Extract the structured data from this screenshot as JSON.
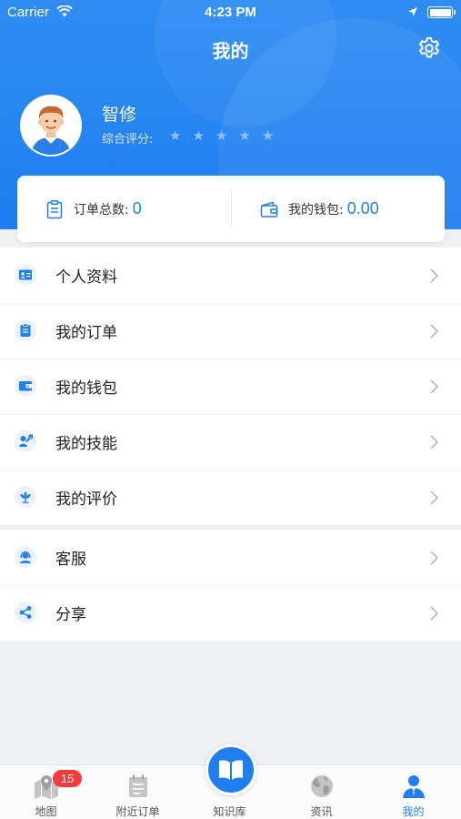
{
  "status_bar": {
    "carrier": "Carrier",
    "time": "4:23 PM"
  },
  "header": {
    "title": "我的"
  },
  "profile": {
    "name": "智修",
    "rating_label": "综合评分:",
    "rating_stars": 5,
    "rating_filled": 0
  },
  "stats": {
    "orders_label": "订单总数:",
    "orders_value": "0",
    "wallet_label": "我的钱包:",
    "wallet_value": "0.00"
  },
  "menu_group1": [
    {
      "label": "个人资料",
      "icon": "id-card-icon"
    },
    {
      "label": "我的订单",
      "icon": "clipboard-icon"
    },
    {
      "label": "我的钱包",
      "icon": "wallet-icon"
    },
    {
      "label": "我的技能",
      "icon": "wrench-icon"
    },
    {
      "label": "我的评价",
      "icon": "flower-icon"
    }
  ],
  "menu_group2": [
    {
      "label": "客服",
      "icon": "customer-service-icon"
    },
    {
      "label": "分享",
      "icon": "share-icon"
    }
  ],
  "tabbar": {
    "tabs": [
      {
        "label": "地图",
        "icon": "map-pin-icon",
        "badge": "15"
      },
      {
        "label": "附近订单",
        "icon": "calendar-icon"
      },
      {
        "label": "知识库",
        "icon": "book-icon"
      },
      {
        "label": "资讯",
        "icon": "globe-icon"
      },
      {
        "label": "我的",
        "icon": "user-icon",
        "active": true
      }
    ]
  },
  "colors": {
    "primary": "#1f7ef0",
    "badge": "#f23c3c",
    "background": "#eff0f3"
  }
}
